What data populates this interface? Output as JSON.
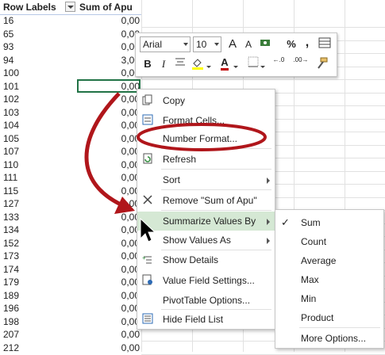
{
  "pivot": {
    "header_row_labels": "Row Labels",
    "header_sum": "Sum of Apu",
    "rows": [
      {
        "label": "16",
        "value": "0,00"
      },
      {
        "label": "65",
        "value": "0,00"
      },
      {
        "label": "93",
        "value": "0,00"
      },
      {
        "label": "94",
        "value": "3,00"
      },
      {
        "label": "100",
        "value": "0,00"
      },
      {
        "label": "101",
        "value": "0,00"
      },
      {
        "label": "102",
        "value": "0,00"
      },
      {
        "label": "103",
        "value": "0,00"
      },
      {
        "label": "104",
        "value": "0,00"
      },
      {
        "label": "105",
        "value": "0,00"
      },
      {
        "label": "107",
        "value": "0,00"
      },
      {
        "label": "110",
        "value": "0,00"
      },
      {
        "label": "111",
        "value": "0,00"
      },
      {
        "label": "115",
        "value": "0,00"
      },
      {
        "label": "127",
        "value": "0,00"
      },
      {
        "label": "133",
        "value": "0,00"
      },
      {
        "label": "134",
        "value": "0,00"
      },
      {
        "label": "152",
        "value": "0,00"
      },
      {
        "label": "173",
        "value": "0,00"
      },
      {
        "label": "174",
        "value": "0,00"
      },
      {
        "label": "179",
        "value": "0,00"
      },
      {
        "label": "189",
        "value": "0,00"
      },
      {
        "label": "196",
        "value": "0,00"
      },
      {
        "label": "198",
        "value": "0,00"
      },
      {
        "label": "207",
        "value": "0,00"
      },
      {
        "label": "212",
        "value": "0,00"
      }
    ]
  },
  "mini_toolbar": {
    "font_name": "Arial",
    "font_size": "10",
    "bold": "B",
    "italic": "I",
    "grow_font": "A",
    "shrink_font": "A",
    "percent": "%",
    "comma": ",",
    "font_color_letter": "A",
    "increase_decimal": "←.0",
    "decrease_decimal": ".00→"
  },
  "context_menu": {
    "items": [
      {
        "label": "Copy",
        "icon": "copy-icon"
      },
      {
        "label": "Format Cells...",
        "icon": "format-cells-icon"
      },
      {
        "label": "Number Format...",
        "icon": ""
      },
      {
        "label": "Refresh",
        "icon": "refresh-icon"
      },
      {
        "label": "Sort",
        "icon": ""
      },
      {
        "label": "Remove \"Sum of Apu\"",
        "icon": "remove-x-icon"
      },
      {
        "label": "Summarize Values By",
        "icon": ""
      },
      {
        "label": "Show Values As",
        "icon": ""
      },
      {
        "label": "Show Details",
        "icon": "show-details-icon"
      },
      {
        "label": "Value Field Settings...",
        "icon": "field-settings-icon"
      },
      {
        "label": "PivotTable Options...",
        "icon": ""
      },
      {
        "label": "Hide Field List",
        "icon": "field-list-icon"
      }
    ]
  },
  "submenu": {
    "items": [
      {
        "label": "Sum",
        "checked": true
      },
      {
        "label": "Count",
        "checked": false
      },
      {
        "label": "Average",
        "checked": false
      },
      {
        "label": "Max",
        "checked": false
      },
      {
        "label": "Min",
        "checked": false
      },
      {
        "label": "Product",
        "checked": false
      },
      {
        "label": "More Options...",
        "checked": false
      }
    ]
  },
  "colors": {
    "annotation_red": "#b0161b",
    "highlight_green": "#d5e8d4",
    "selection_green": "#217346"
  }
}
